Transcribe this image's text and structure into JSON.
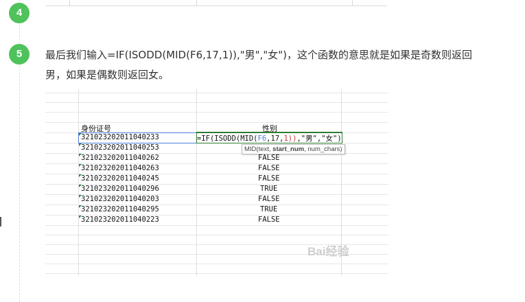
{
  "steps": [
    {
      "number": "4"
    },
    {
      "number": "5",
      "text": "最后我们输入=IF(ISODD(MID(F6,17,1)),\"男\",\"女\")，这个函数的意思就是如果是奇数则返回男，如果是偶数则返回女。"
    }
  ],
  "sheet": {
    "headers": {
      "id": "身份证号",
      "gender": "性别"
    },
    "formula": {
      "prefix": "=IF(ISODD(MID(",
      "ref": "F6",
      "mid": ",17",
      "sep": ",",
      "one": "1",
      "close_parens": "))",
      "suffix": ",\"男\",\"女\")"
    },
    "tooltip": {
      "fn": "MID(",
      "arg1": "text",
      "arg2": "start_num",
      "arg3": "num_chars",
      "close": ")"
    },
    "rows": [
      {
        "id": "321023202011040233",
        "value": ""
      },
      {
        "id": "321023202011040253",
        "value": ""
      },
      {
        "id": "321023202011040262",
        "value": "FALSE"
      },
      {
        "id": "321023202011040263",
        "value": "FALSE"
      },
      {
        "id": "321023202011040245",
        "value": "FALSE"
      },
      {
        "id": "321023202011040296",
        "value": "TRUE"
      },
      {
        "id": "321023202011040203",
        "value": "FALSE"
      },
      {
        "id": "321023202011040295",
        "value": "TRUE"
      },
      {
        "id": "321023202011040223",
        "value": "FALSE"
      }
    ]
  },
  "watermark": "Bai经验",
  "colors": {
    "step_green": "#4fc25b",
    "select_blue": "#4a80d9",
    "edit_green": "#2e7d32",
    "ref_red": "#cc3333"
  }
}
